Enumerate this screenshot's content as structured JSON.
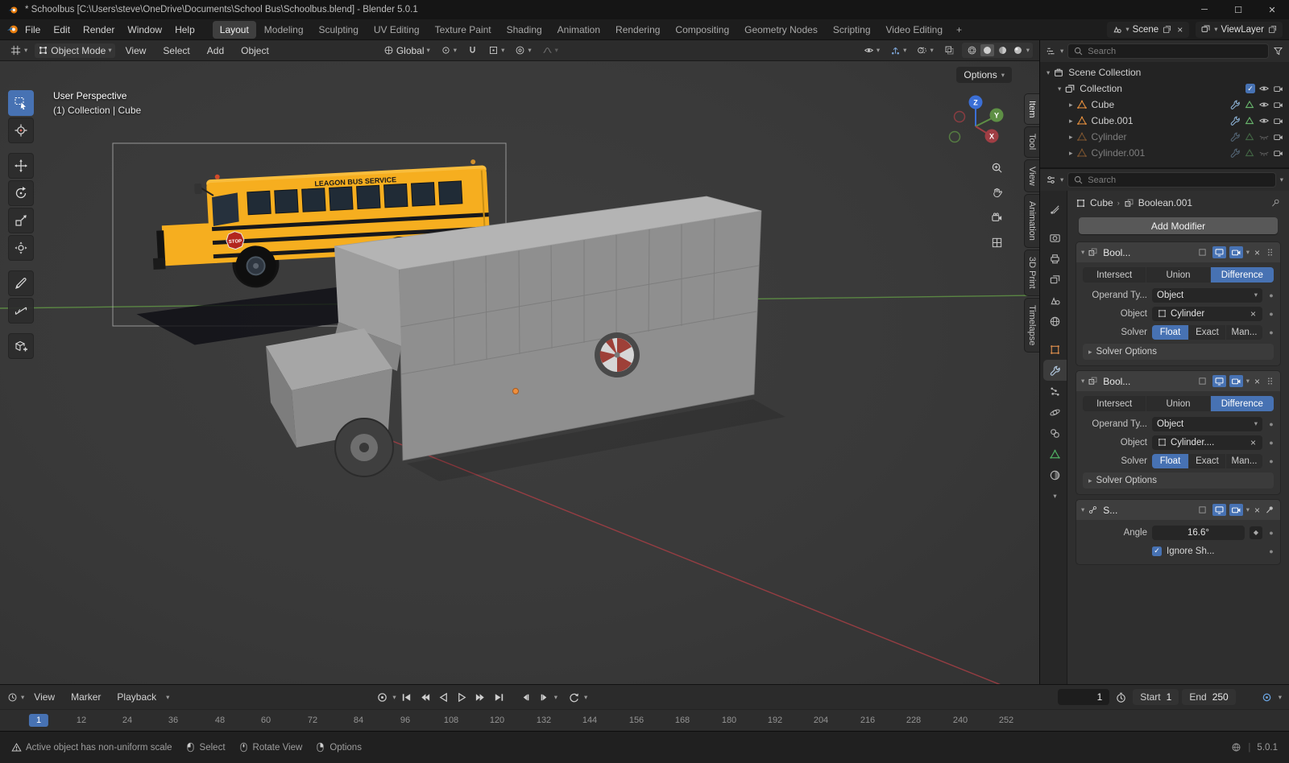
{
  "titlebar": {
    "title": "* Schoolbus [C:\\Users\\steve\\OneDrive\\Documents\\School Bus\\Schoolbus.blend] - Blender 5.0.1"
  },
  "topbar": {
    "menus": [
      "File",
      "Edit",
      "Render",
      "Window",
      "Help"
    ],
    "workspaces": [
      "Layout",
      "Modeling",
      "Sculpting",
      "UV Editing",
      "Texture Paint",
      "Shading",
      "Animation",
      "Rendering",
      "Compositing",
      "Geometry Nodes",
      "Scripting",
      "Video Editing"
    ],
    "add_tab": "+",
    "scene_label": "Scene",
    "viewlayer_label": "ViewLayer"
  },
  "viewport": {
    "header": {
      "mode": "Object Mode",
      "menu_view": "View",
      "menu_select": "Select",
      "menu_add": "Add",
      "menu_object": "Object",
      "orientation": "Global"
    },
    "options_label": "Options",
    "overlay_line1": "User Perspective",
    "overlay_line2": "(1) Collection | Cube",
    "axis_x": "X",
    "axis_y": "Y",
    "axis_z": "Z",
    "sidebar_tabs": [
      "Item",
      "Tool",
      "View",
      "Animation",
      "3D Print",
      "Timelapse"
    ],
    "reference": {
      "side_text": "LEAGON BUS SERVICE",
      "stop_text": "STOP"
    }
  },
  "outliner": {
    "search_placeholder": "Search",
    "items": [
      {
        "label": "Scene Collection"
      },
      {
        "label": "Collection"
      },
      {
        "label": "Cube"
      },
      {
        "label": "Cube.001"
      },
      {
        "label": "Cylinder"
      },
      {
        "label": "Cylinder.001"
      }
    ]
  },
  "properties": {
    "search_placeholder": "Search",
    "breadcrumb_object": "Cube",
    "breadcrumb_modifier": "Boolean.001",
    "add_modifier_label": "Add Modifier",
    "modifier1": {
      "name": "Bool...",
      "op1": "Intersect",
      "op2": "Union",
      "op3": "Difference",
      "operand_label": "Operand Ty...",
      "operand_value": "Object",
      "object_label": "Object",
      "object_value": "Cylinder",
      "solver_label": "Solver",
      "solver1": "Float",
      "solver2": "Exact",
      "solver3": "Man...",
      "options_label": "Solver Options"
    },
    "modifier2": {
      "name": "Bool...",
      "op1": "Intersect",
      "op2": "Union",
      "op3": "Difference",
      "operand_label": "Operand Ty...",
      "operand_value": "Object",
      "object_label": "Object",
      "object_value": "Cylinder....",
      "solver_label": "Solver",
      "solver1": "Float",
      "solver2": "Exact",
      "solver3": "Man...",
      "options_label": "Solver Options"
    },
    "modifier3": {
      "name": "S...",
      "angle_label": "Angle",
      "angle_value": "16.6°",
      "ignore_label": "Ignore Sh..."
    }
  },
  "timeline": {
    "menu_view": "View",
    "menu_marker": "Marker",
    "menu_playback": "Playback",
    "current_frame": "1",
    "start_label": "Start",
    "start_value": "1",
    "end_label": "End",
    "end_value": "250",
    "ruler": [
      "1",
      "12",
      "24",
      "36",
      "48",
      "60",
      "72",
      "84",
      "96",
      "108",
      "120",
      "132",
      "144",
      "156",
      "168",
      "180",
      "192",
      "204",
      "216",
      "228",
      "240",
      "252"
    ]
  },
  "statusbar": {
    "warning": "Active object has non-uniform scale",
    "hint_select": "Select",
    "hint_rotate": "Rotate View",
    "hint_options": "Options",
    "version": "5.0.1"
  },
  "colors": {
    "accent": "#4772b3",
    "bus_yellow": "#f6ae1f",
    "axis_x_red": "#a03e44",
    "axis_y_green": "#5e8f45",
    "axis_z_blue": "#3b6fd6"
  }
}
